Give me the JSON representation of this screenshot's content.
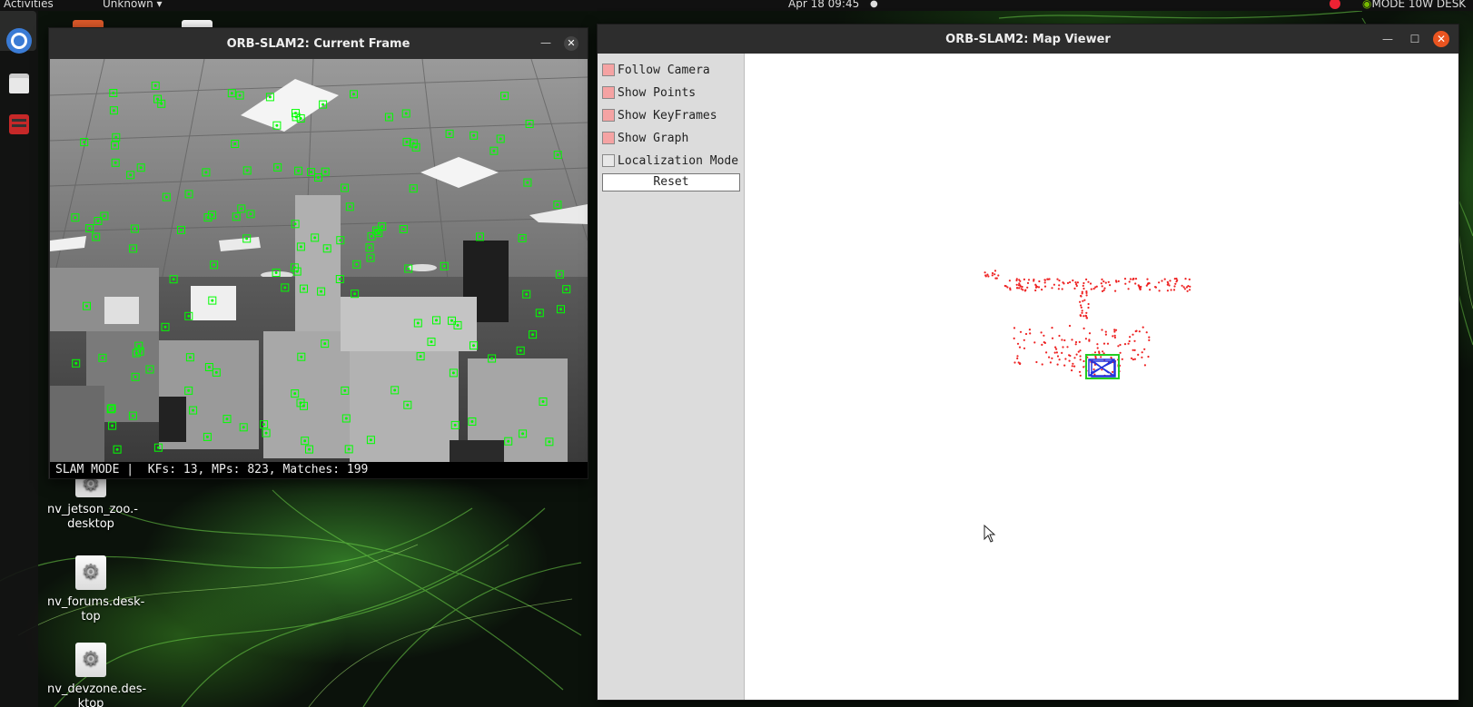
{
  "topbar": {
    "activities": "Activities",
    "app_menu": "Unknown",
    "clock": "Apr 18  09:45",
    "nv_mode": "MODE 10W DESK"
  },
  "dock": {
    "items": [
      "chromium-icon",
      "files-icon",
      "app-icon"
    ]
  },
  "desktop": {
    "icons": [
      {
        "label_line1": "nv_jetson_zoo.-",
        "label_line2": "desktop"
      },
      {
        "label_line1": "nv_forums.desk-",
        "label_line2": "top"
      },
      {
        "label_line1": "nv_devzone.des-",
        "label_line2": "ktop"
      }
    ]
  },
  "frame_window": {
    "title": "ORB-SLAM2: Current Frame",
    "status": "SLAM MODE |  KFs: 13, MPs: 823, Matches: 199"
  },
  "map_window": {
    "title": "ORB-SLAM2: Map Viewer",
    "options": [
      {
        "label": "Follow Camera",
        "checked": true
      },
      {
        "label": "Show Points",
        "checked": true
      },
      {
        "label": "Show KeyFrames",
        "checked": true
      },
      {
        "label": "Show Graph",
        "checked": true
      },
      {
        "label": "Localization Mode",
        "checked": false
      }
    ],
    "reset_label": "Reset"
  },
  "colors": {
    "feature": "#00ff00",
    "map_point": "#ee2222",
    "keyframe": "#2233dd",
    "current_camera": "#22cc22",
    "close_accent": "#e95420",
    "checkbox_on": "#f5a3a3"
  }
}
